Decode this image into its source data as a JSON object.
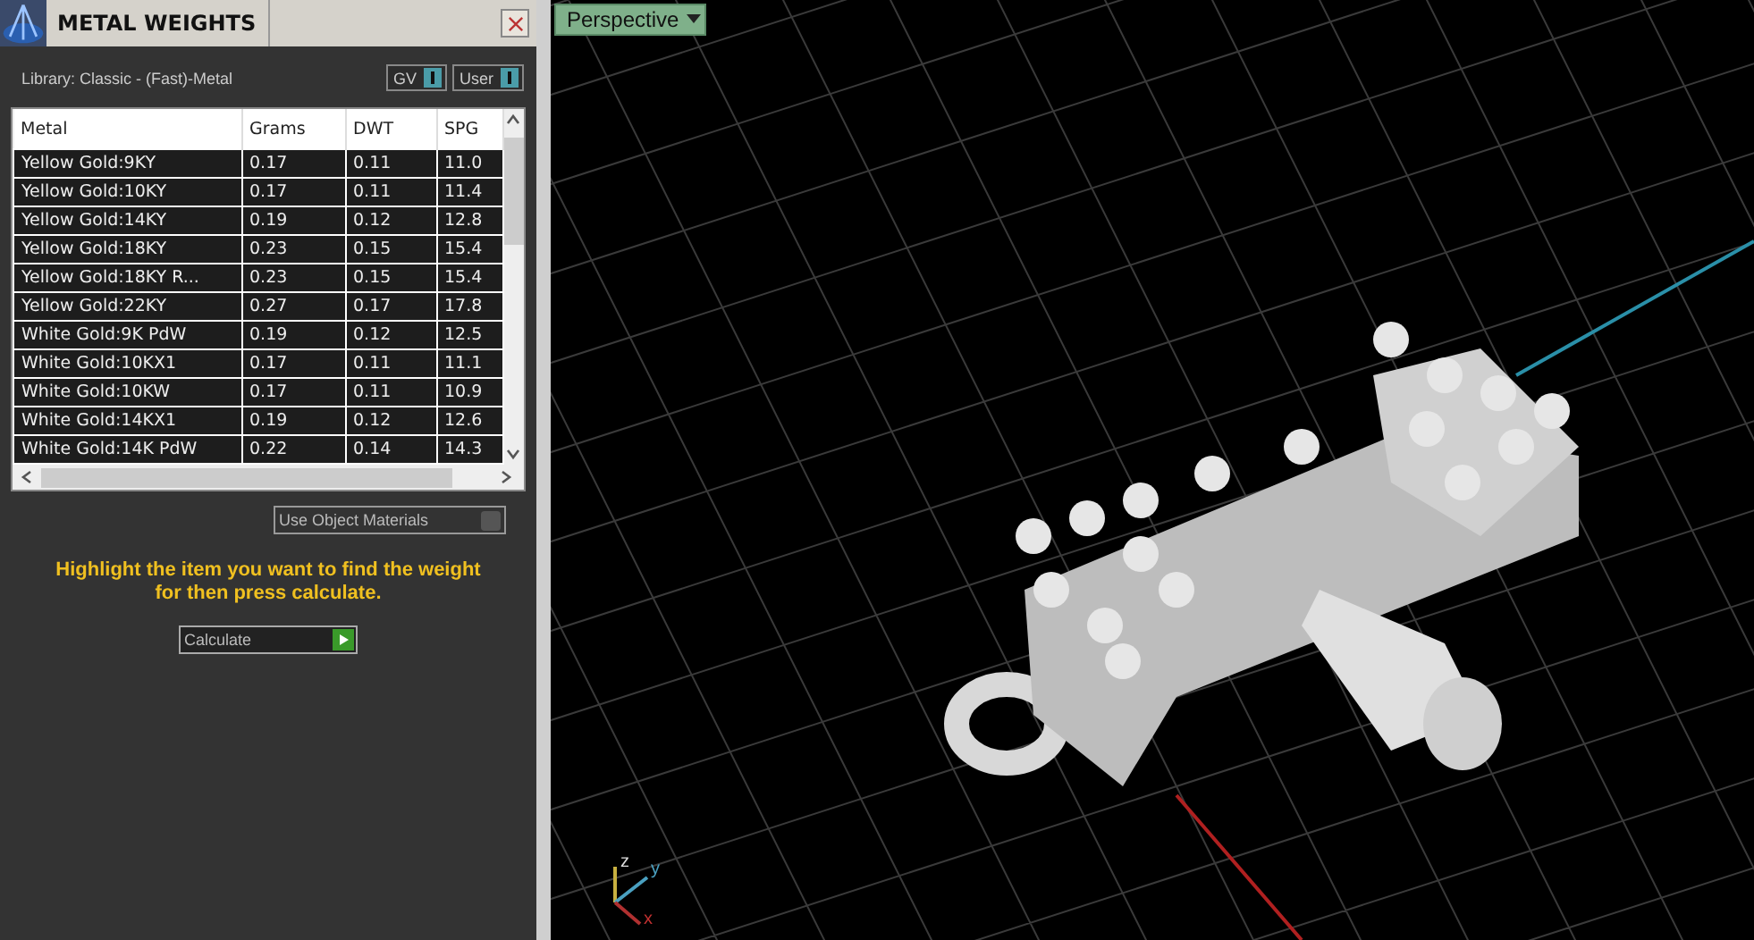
{
  "panel": {
    "title": "METAL WEIGHTS",
    "library": "Library: Classic - (Fast)-Metal",
    "toggles": [
      {
        "label": "GV",
        "on": true
      },
      {
        "label": "User",
        "on": true
      }
    ],
    "table": {
      "columns": [
        "Metal",
        "Grams",
        "DWT",
        "SPG"
      ],
      "rows": [
        {
          "cells": [
            "Yellow Gold:9KY",
            "0.17",
            "0.11",
            "11.0"
          ]
        },
        {
          "cells": [
            "Yellow Gold:10KY",
            "0.17",
            "0.11",
            "11.4"
          ]
        },
        {
          "cells": [
            "Yellow Gold:14KY",
            "0.19",
            "0.12",
            "12.8"
          ]
        },
        {
          "cells": [
            "Yellow Gold:18KY",
            "0.23",
            "0.15",
            "15.4"
          ]
        },
        {
          "cells": [
            "Yellow Gold:18KY R...",
            "0.23",
            "0.15",
            "15.4"
          ]
        },
        {
          "cells": [
            "Yellow Gold:22KY",
            "0.27",
            "0.17",
            "17.8"
          ]
        },
        {
          "cells": [
            "White Gold:9K PdW",
            "0.19",
            "0.12",
            "12.5"
          ]
        },
        {
          "cells": [
            "White Gold:10KX1",
            "0.17",
            "0.11",
            "11.1"
          ]
        },
        {
          "cells": [
            "White Gold:10KW",
            "0.17",
            "0.11",
            "10.9"
          ]
        },
        {
          "cells": [
            "White Gold:14KX1",
            "0.19",
            "0.12",
            "12.6"
          ]
        },
        {
          "cells": [
            "White Gold:14K PdW",
            "0.22",
            "0.14",
            "14.3"
          ]
        }
      ]
    },
    "use_object_materials": {
      "label": "Use Object Materials",
      "checked": false
    },
    "instructions": "Highlight the item you want to find the weight for then press calculate.",
    "calculate": "Calculate"
  },
  "viewport": {
    "view": "Perspective",
    "axes": [
      "z",
      "y",
      "x"
    ]
  }
}
